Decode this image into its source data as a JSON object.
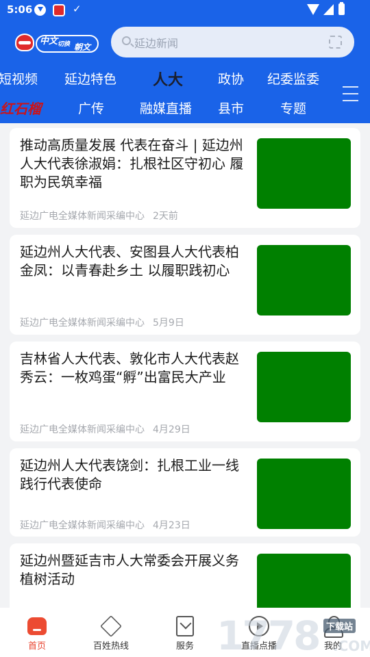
{
  "status_bar": {
    "time": "5:06"
  },
  "logo": {
    "zh": "中文",
    "switch": "切换",
    "kr": "朝文"
  },
  "search": {
    "placeholder": "延边新闻"
  },
  "tabs_row1": [
    "短视频",
    "延边特色",
    "人大",
    "政协",
    "纪委监委"
  ],
  "tabs_row1_active_index": 2,
  "tabs_row2_special": "红石榴",
  "tabs_row2": [
    "广传",
    "融媒直播",
    "县市",
    "专题"
  ],
  "articles": [
    {
      "title": "推动高质量发展 代表在奋斗 | 延边州人大代表徐淑娟：扎根社区守初心 履职为民筑幸福",
      "source": "延边广电全媒体新闻采编中心",
      "date": "2天前"
    },
    {
      "title": "延边州人大代表、安图县人大代表柏金凤：以青春赴乡土 以履职践初心",
      "source": "延边广电全媒体新闻采编中心",
      "date": "5月9日"
    },
    {
      "title": "吉林省人大代表、敦化市人大代表赵秀云：一枚鸡蛋“孵”出富民大产业",
      "source": "延边广电全媒体新闻采编中心",
      "date": "4月29日"
    },
    {
      "title": "延边州人大代表饶剑：扎根工业一线 践行代表使命",
      "source": "延边广电全媒体新闻采编中心",
      "date": "4月23日"
    },
    {
      "title": "延边州暨延吉市人大常委会开展义务植树活动",
      "source": "",
      "date": ""
    }
  ],
  "bottom_nav": [
    {
      "label": "首页",
      "icon": "home-icon",
      "active": true
    },
    {
      "label": "百姓热线",
      "icon": "hotline-icon",
      "active": false
    },
    {
      "label": "服务",
      "icon": "service-icon",
      "active": false
    },
    {
      "label": "直播点播",
      "icon": "play-icon",
      "active": false
    },
    {
      "label": "我的",
      "icon": "user-icon",
      "active": false
    }
  ],
  "watermark": {
    "number": "1778",
    "tag": "下载站",
    "suffix": ".COM"
  },
  "colors": {
    "header_blue": "#1a63e8",
    "accent_red": "#ec4b32",
    "thumb_green": "#008000"
  }
}
